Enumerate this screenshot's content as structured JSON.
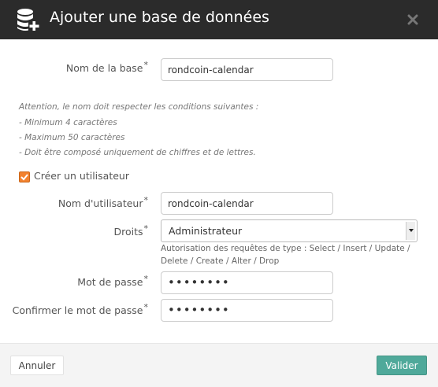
{
  "header": {
    "title": "Ajouter une base de données",
    "icon": "database-add-icon",
    "close_icon": "close-icon"
  },
  "form": {
    "db_name": {
      "label": "Nom de la base",
      "required": "*",
      "value": "rondcoin-calendar"
    },
    "notes": [
      "Attention, le nom doit respecter les conditions suivantes :",
      "- Minimum 4 caractères",
      "- Maximum 50 caractères",
      "- Doit être composé uniquement de chiffres et de lettres."
    ],
    "create_user": {
      "label": "Créer un utilisateur",
      "checked": true
    },
    "username": {
      "label": "Nom d'utilisateur",
      "required": "*",
      "value": "rondcoin-calendar"
    },
    "rights": {
      "label": "Droits",
      "required": "*",
      "value": "Administrateur",
      "help_line1": "Autorisation des requêtes de type : Select / Insert / Update /",
      "help_line2": "Delete / Create / Alter / Drop"
    },
    "password": {
      "label": "Mot de passe",
      "required": "*",
      "value": "••••••••"
    },
    "password_confirm": {
      "label": "Confirmer le mot de passe",
      "required": "*",
      "value": "••••••••"
    }
  },
  "footer": {
    "cancel_label": "Annuler",
    "submit_label": "Valider"
  },
  "colors": {
    "header_bg": "#2b2b2b",
    "accent": "#f2822f",
    "submit": "#4fa99a"
  }
}
